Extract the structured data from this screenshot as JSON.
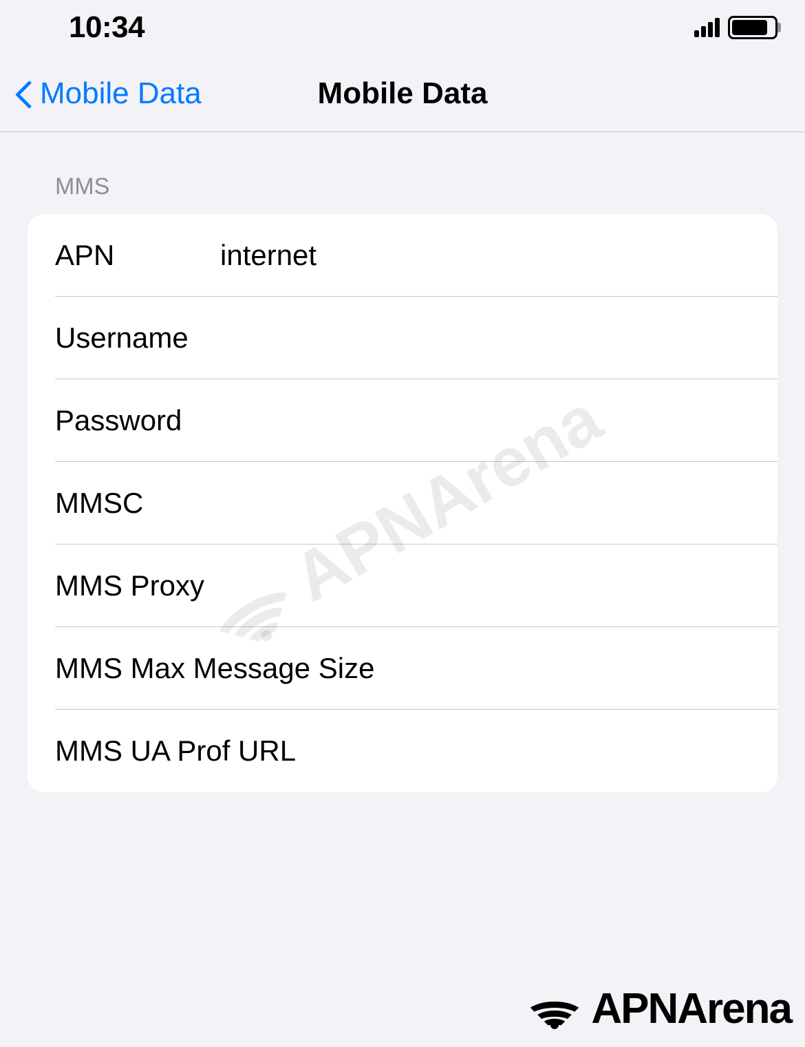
{
  "status_bar": {
    "time": "10:34"
  },
  "nav": {
    "back_label": "Mobile Data",
    "title": "Mobile Data"
  },
  "section": {
    "header": "MMS"
  },
  "rows": {
    "apn": {
      "label": "APN",
      "value": "internet"
    },
    "username": {
      "label": "Username",
      "value": ""
    },
    "password": {
      "label": "Password",
      "value": ""
    },
    "mmsc": {
      "label": "MMSC",
      "value": ""
    },
    "mms_proxy": {
      "label": "MMS Proxy",
      "value": ""
    },
    "mms_max_size": {
      "label": "MMS Max Message Size",
      "value": ""
    },
    "mms_ua_prof": {
      "label": "MMS UA Prof URL",
      "value": ""
    }
  },
  "watermark": {
    "text": "APNArena"
  },
  "footer": {
    "text": "APNArena"
  }
}
